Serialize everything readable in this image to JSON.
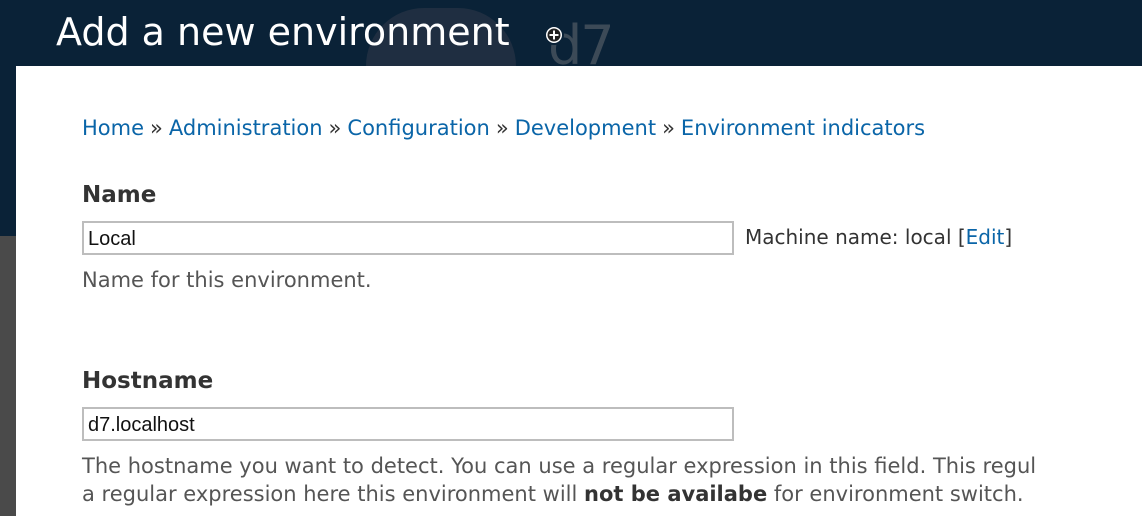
{
  "header": {
    "title": "Add a new environment",
    "watermark": "d7",
    "shortcut_icon": "plus-circle-icon"
  },
  "breadcrumb": {
    "items": [
      "Home",
      "Administration",
      "Configuration",
      "Development",
      "Environment indicators"
    ],
    "separator": "»"
  },
  "name_field": {
    "label": "Name",
    "value": "Local",
    "machine_prefix": "Machine name: local",
    "machine_open": "[",
    "machine_edit": "Edit",
    "machine_close": "]",
    "description": "Name for this environment."
  },
  "hostname_field": {
    "label": "Hostname",
    "value": "d7.localhost",
    "description_line1": "The hostname you want to detect. You can use a regular expression in this field. This regul",
    "description_line2_pre": "a regular expression here this environment will ",
    "description_line2_bold": "not be availabe",
    "description_line2_post": " for environment switch."
  },
  "colors": {
    "header_bg": "#0a2237",
    "link": "#0a65a8",
    "text": "#333333"
  }
}
